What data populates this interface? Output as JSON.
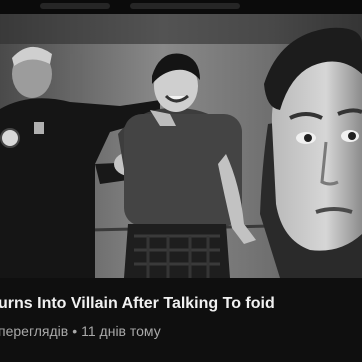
{
  "video": {
    "title": "urns Into Villain After Talking To foid",
    "views": "переглядів",
    "separator": "•",
    "age": "11 днів тому"
  },
  "thumbnail": {
    "style": "black-and-white photo",
    "subjects": [
      "police officer",
      "smiling young man",
      "close-up frowning face"
    ]
  },
  "colors": {
    "background": "#0f0f0f",
    "title_text": "#f1f1f1",
    "meta_text": "#a9a9a9"
  }
}
